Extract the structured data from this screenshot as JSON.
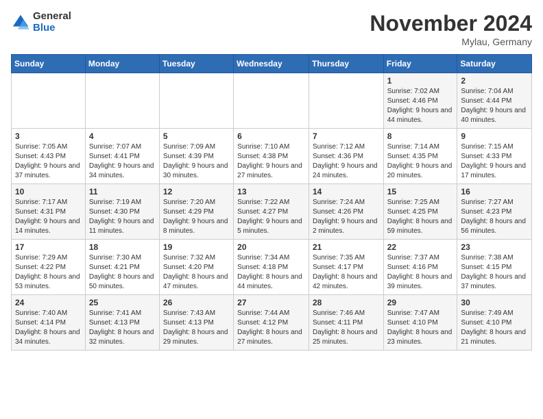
{
  "header": {
    "logo_general": "General",
    "logo_blue": "Blue",
    "month_title": "November 2024",
    "location": "Mylau, Germany"
  },
  "weekdays": [
    "Sunday",
    "Monday",
    "Tuesday",
    "Wednesday",
    "Thursday",
    "Friday",
    "Saturday"
  ],
  "weeks": [
    [
      {
        "day": "",
        "info": ""
      },
      {
        "day": "",
        "info": ""
      },
      {
        "day": "",
        "info": ""
      },
      {
        "day": "",
        "info": ""
      },
      {
        "day": "",
        "info": ""
      },
      {
        "day": "1",
        "info": "Sunrise: 7:02 AM\nSunset: 4:46 PM\nDaylight: 9 hours and 44 minutes."
      },
      {
        "day": "2",
        "info": "Sunrise: 7:04 AM\nSunset: 4:44 PM\nDaylight: 9 hours and 40 minutes."
      }
    ],
    [
      {
        "day": "3",
        "info": "Sunrise: 7:05 AM\nSunset: 4:43 PM\nDaylight: 9 hours and 37 minutes."
      },
      {
        "day": "4",
        "info": "Sunrise: 7:07 AM\nSunset: 4:41 PM\nDaylight: 9 hours and 34 minutes."
      },
      {
        "day": "5",
        "info": "Sunrise: 7:09 AM\nSunset: 4:39 PM\nDaylight: 9 hours and 30 minutes."
      },
      {
        "day": "6",
        "info": "Sunrise: 7:10 AM\nSunset: 4:38 PM\nDaylight: 9 hours and 27 minutes."
      },
      {
        "day": "7",
        "info": "Sunrise: 7:12 AM\nSunset: 4:36 PM\nDaylight: 9 hours and 24 minutes."
      },
      {
        "day": "8",
        "info": "Sunrise: 7:14 AM\nSunset: 4:35 PM\nDaylight: 9 hours and 20 minutes."
      },
      {
        "day": "9",
        "info": "Sunrise: 7:15 AM\nSunset: 4:33 PM\nDaylight: 9 hours and 17 minutes."
      }
    ],
    [
      {
        "day": "10",
        "info": "Sunrise: 7:17 AM\nSunset: 4:31 PM\nDaylight: 9 hours and 14 minutes."
      },
      {
        "day": "11",
        "info": "Sunrise: 7:19 AM\nSunset: 4:30 PM\nDaylight: 9 hours and 11 minutes."
      },
      {
        "day": "12",
        "info": "Sunrise: 7:20 AM\nSunset: 4:29 PM\nDaylight: 9 hours and 8 minutes."
      },
      {
        "day": "13",
        "info": "Sunrise: 7:22 AM\nSunset: 4:27 PM\nDaylight: 9 hours and 5 minutes."
      },
      {
        "day": "14",
        "info": "Sunrise: 7:24 AM\nSunset: 4:26 PM\nDaylight: 9 hours and 2 minutes."
      },
      {
        "day": "15",
        "info": "Sunrise: 7:25 AM\nSunset: 4:25 PM\nDaylight: 8 hours and 59 minutes."
      },
      {
        "day": "16",
        "info": "Sunrise: 7:27 AM\nSunset: 4:23 PM\nDaylight: 8 hours and 56 minutes."
      }
    ],
    [
      {
        "day": "17",
        "info": "Sunrise: 7:29 AM\nSunset: 4:22 PM\nDaylight: 8 hours and 53 minutes."
      },
      {
        "day": "18",
        "info": "Sunrise: 7:30 AM\nSunset: 4:21 PM\nDaylight: 8 hours and 50 minutes."
      },
      {
        "day": "19",
        "info": "Sunrise: 7:32 AM\nSunset: 4:20 PM\nDaylight: 8 hours and 47 minutes."
      },
      {
        "day": "20",
        "info": "Sunrise: 7:34 AM\nSunset: 4:18 PM\nDaylight: 8 hours and 44 minutes."
      },
      {
        "day": "21",
        "info": "Sunrise: 7:35 AM\nSunset: 4:17 PM\nDaylight: 8 hours and 42 minutes."
      },
      {
        "day": "22",
        "info": "Sunrise: 7:37 AM\nSunset: 4:16 PM\nDaylight: 8 hours and 39 minutes."
      },
      {
        "day": "23",
        "info": "Sunrise: 7:38 AM\nSunset: 4:15 PM\nDaylight: 8 hours and 37 minutes."
      }
    ],
    [
      {
        "day": "24",
        "info": "Sunrise: 7:40 AM\nSunset: 4:14 PM\nDaylight: 8 hours and 34 minutes."
      },
      {
        "day": "25",
        "info": "Sunrise: 7:41 AM\nSunset: 4:13 PM\nDaylight: 8 hours and 32 minutes."
      },
      {
        "day": "26",
        "info": "Sunrise: 7:43 AM\nSunset: 4:13 PM\nDaylight: 8 hours and 29 minutes."
      },
      {
        "day": "27",
        "info": "Sunrise: 7:44 AM\nSunset: 4:12 PM\nDaylight: 8 hours and 27 minutes."
      },
      {
        "day": "28",
        "info": "Sunrise: 7:46 AM\nSunset: 4:11 PM\nDaylight: 8 hours and 25 minutes."
      },
      {
        "day": "29",
        "info": "Sunrise: 7:47 AM\nSunset: 4:10 PM\nDaylight: 8 hours and 23 minutes."
      },
      {
        "day": "30",
        "info": "Sunrise: 7:49 AM\nSunset: 4:10 PM\nDaylight: 8 hours and 21 minutes."
      }
    ]
  ]
}
